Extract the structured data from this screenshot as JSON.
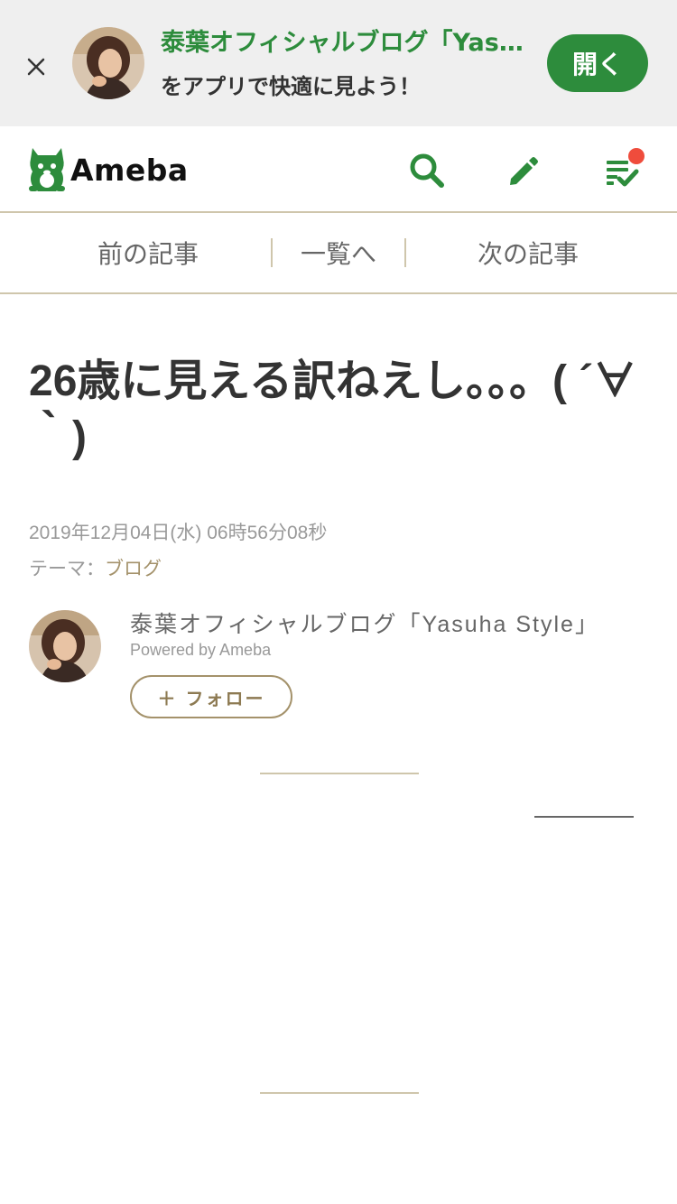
{
  "banner": {
    "title": "泰葉オフィシャルブログ「Yasuha Style」",
    "subtitle": "をアプリで快適に見よう！",
    "open_label": "開く",
    "close_icon": "close-icon"
  },
  "header": {
    "logo_text": "Ameba",
    "icons": [
      "search-icon",
      "edit-pencil-icon",
      "reading-list-icon"
    ],
    "notification_badge": true,
    "brand_color": "#2d8c3c"
  },
  "nav": {
    "prev_label": "前の記事",
    "list_label": "一覧へ",
    "next_label": "次の記事"
  },
  "article": {
    "title": "26歳に見える訳ねえし。。。( ´∀｀)",
    "date": "2019年12月04日(水) 06時56分08秒",
    "theme_prefix": "テーマ：",
    "theme_link": "ブログ"
  },
  "author": {
    "name": "泰葉オフィシャルブログ「Yasuha Style」",
    "powered": "Powered by Ameba",
    "follow_label": "＋ フォロー"
  },
  "colors": {
    "accent_green": "#2d8c3c",
    "gold": "#a4926b",
    "divider": "#cfc6ac",
    "notify_red": "#ef4c3c"
  }
}
